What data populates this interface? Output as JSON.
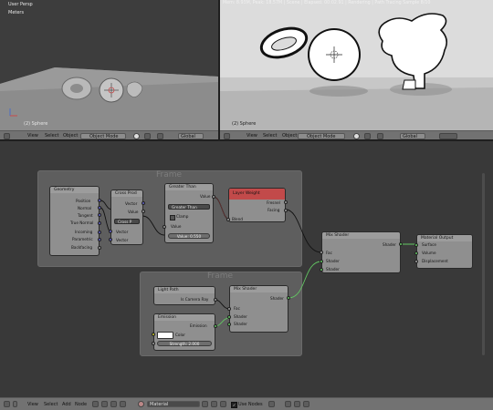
{
  "left_view": {
    "title": "User Persp",
    "units": "Meters",
    "object_label": "(2) Sphere"
  },
  "right_view": {
    "status": "Mem: 8.93M, Peak: 18.57M | Scene | Elapsed: 00:02.91 | Rendering | Path Tracing Sample 8/10",
    "object_label": "(2) Sphere"
  },
  "view_header": {
    "view": "View",
    "select": "Select",
    "object": "Object",
    "mode": "Object Mode",
    "global": "Global"
  },
  "frames": {
    "top": "Frame",
    "bottom": "Frame"
  },
  "nodes": {
    "geometry": {
      "title": "Geometry",
      "outputs": [
        "Position",
        "Normal",
        "Tangent",
        "True Normal",
        "Incoming",
        "Parametric",
        "Backfacing"
      ]
    },
    "cross": {
      "title": "Cross Prod",
      "outputs": [
        "Vector",
        "Value"
      ],
      "operation": "Cross P",
      "inputs": [
        "Vector",
        "Vector"
      ]
    },
    "greater": {
      "title": "Greater Than",
      "outputs": [
        "Value"
      ],
      "operation": "Greater Than",
      "clamp": "Clamp",
      "input_label": "Value",
      "value": "Value: 0.550"
    },
    "layer_weight": {
      "title": "Layer Weight",
      "outputs": [
        "Fresnel",
        "Facing"
      ],
      "input": "Blend"
    },
    "mix1": {
      "title": "Mix Shader",
      "output": "Shader",
      "inputs": [
        "Fac",
        "Shader",
        "Shader"
      ]
    },
    "output": {
      "title": "Material Output",
      "inputs": [
        "Surface",
        "Volume",
        "Displacement"
      ]
    },
    "light_path": {
      "title": "Light Path",
      "output": "Is Camera Ray"
    },
    "mix2": {
      "title": "Mix Shader",
      "output": "Shader",
      "inputs": [
        "Fac",
        "Shader",
        "Shader"
      ]
    },
    "emission": {
      "title": "Emission",
      "output": "Emission",
      "color_label": "Color",
      "strength": "Strength: 2.000"
    }
  },
  "node_header": {
    "view": "View",
    "select": "Select",
    "add": "Add",
    "node": "Node",
    "material": "Material",
    "use_nodes": "Use Nodes"
  }
}
